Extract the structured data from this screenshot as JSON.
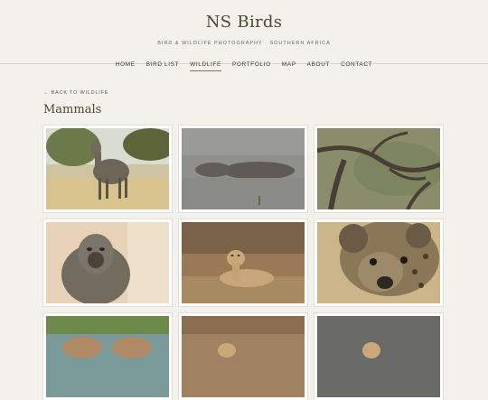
{
  "header": {
    "title": "NS Birds",
    "tagline": "BIRD & WILDLIFE PHOTOGRAPHY · SOUTHERN AFRICA"
  },
  "nav": [
    {
      "label": "HOME",
      "active": false
    },
    {
      "label": "BIRD LIST",
      "active": false
    },
    {
      "label": "WILDLIFE",
      "active": true
    },
    {
      "label": "PORTFOLIO",
      "active": false
    },
    {
      "label": "MAP",
      "active": false
    },
    {
      "label": "ABOUT",
      "active": false
    },
    {
      "label": "CONTACT",
      "active": false
    }
  ],
  "main": {
    "back_link": "← BACK TO WILDLIFE",
    "page_title": "Mammals"
  },
  "colors": {
    "background": "#f3f1ec",
    "title": "#4a4a34",
    "nav_underline": "#7a7a5e"
  }
}
